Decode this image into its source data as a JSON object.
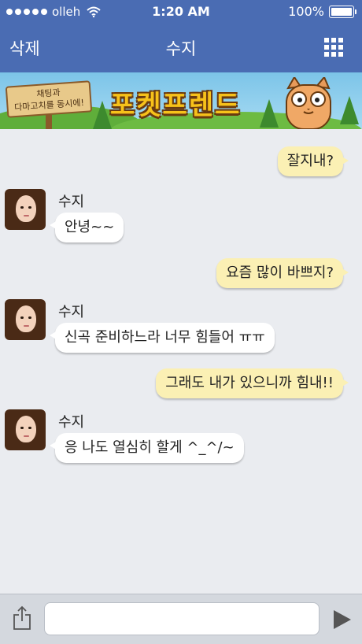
{
  "status_bar": {
    "carrier": "olleh",
    "time": "1:20 AM",
    "battery": "100%"
  },
  "nav": {
    "left_button": "삭제",
    "title": "수지",
    "menu_icon": "grid-icon"
  },
  "banner": {
    "sign_line1": "채팅과",
    "sign_line2": "다마고치를 동시에!",
    "title": "포켓프렌드"
  },
  "messages": [
    {
      "side": "out",
      "text": "잘지내?"
    },
    {
      "side": "in",
      "sender": "수지",
      "text": "안녕~~"
    },
    {
      "side": "out",
      "text": "요즘 많이 바쁘지?"
    },
    {
      "side": "in",
      "sender": "수지",
      "text": "신곡 준비하느라 너무 힘들어 ㅠㅠ"
    },
    {
      "side": "out",
      "text": "그래도 내가 있으니까 힘내!!"
    },
    {
      "side": "in",
      "sender": "수지",
      "text": "응 나도 열심히 할게 ^_^/~"
    }
  ],
  "input_bar": {
    "share_icon": "share-icon",
    "input_value": "",
    "input_placeholder": "",
    "send_icon": "send-triangle-icon"
  },
  "colors": {
    "nav_background": "#4a6cb3",
    "chat_background": "#eaecf0",
    "outgoing_bubble": "#fbf0b4",
    "incoming_bubble": "#ffffff"
  }
}
